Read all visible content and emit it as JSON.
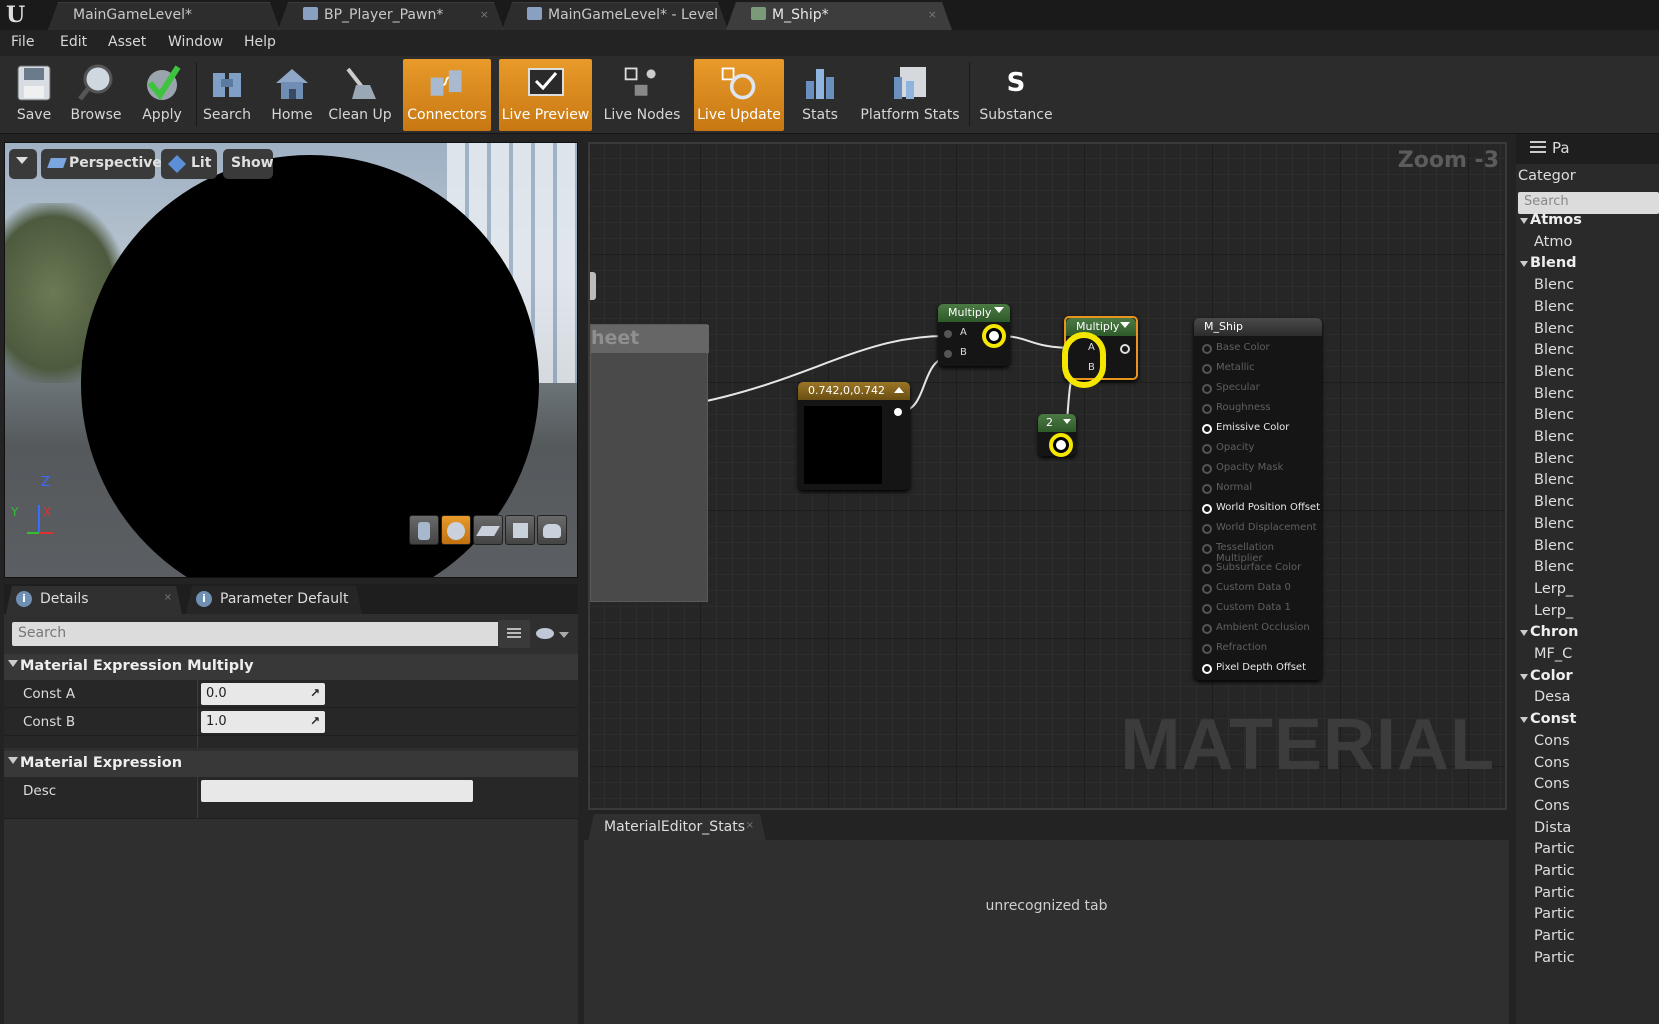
{
  "tabs": [
    {
      "label": "MainGameLevel*",
      "active": false
    },
    {
      "label": "BP_Player_Pawn*",
      "active": false
    },
    {
      "label": "MainGameLevel* - Level",
      "active": false
    },
    {
      "label": "M_Ship*",
      "active": true
    }
  ],
  "menu": [
    "File",
    "Edit",
    "Asset",
    "Window",
    "Help"
  ],
  "toolbar": [
    {
      "label": "Save",
      "icon": "save-icon",
      "on": false
    },
    {
      "label": "Browse",
      "icon": "browse-icon",
      "on": false
    },
    {
      "label": "Apply",
      "icon": "apply-icon",
      "on": false
    },
    {
      "label": "Search",
      "icon": "search-icon",
      "on": false
    },
    {
      "label": "Home",
      "icon": "home-icon",
      "on": false
    },
    {
      "label": "Clean Up",
      "icon": "clean-up-icon",
      "on": false
    },
    {
      "label": "Connectors",
      "icon": "connectors-icon",
      "on": true
    },
    {
      "label": "Live Preview",
      "icon": "live-preview-icon",
      "on": true
    },
    {
      "label": "Live Nodes",
      "icon": "live-nodes-icon",
      "on": false
    },
    {
      "label": "Live Update",
      "icon": "live-update-icon",
      "on": true
    },
    {
      "label": "Stats",
      "icon": "stats-icon",
      "on": false
    },
    {
      "label": "Platform Stats",
      "icon": "platform-stats-icon",
      "on": false
    },
    {
      "label": "Substance",
      "icon": "substance-icon",
      "on": false
    }
  ],
  "viewport": {
    "perspective": "Perspective",
    "lit": "Lit",
    "show": "Show",
    "axis_z": "Z",
    "axis_y": "Y",
    "axis_x": "X"
  },
  "details": {
    "tab_details": "Details",
    "tab_params": "Parameter Default",
    "search_placeholder": "Search",
    "section1": "Material Expression Multiply",
    "const_a_label": "Const A",
    "const_a_value": "0.0",
    "const_b_label": "Const B",
    "const_b_value": "1.0",
    "section2": "Material Expression",
    "desc_label": "Desc",
    "desc_value": ""
  },
  "graph": {
    "zoom": "Zoom -3",
    "watermark": "MATERIAL",
    "comment_title": "heet",
    "multiply1": {
      "title": "Multiply",
      "a": "A",
      "b": "B"
    },
    "multiply2": {
      "title": "Multiply",
      "a": "A",
      "b": "B"
    },
    "constant3": {
      "title": "0.742,0,0.742",
      "color": "#000000"
    },
    "constant": {
      "title": "2"
    },
    "material": {
      "title": "M_Ship",
      "inputs": [
        {
          "label": "Base Color",
          "active": false
        },
        {
          "label": "Metallic",
          "active": false
        },
        {
          "label": "Specular",
          "active": false
        },
        {
          "label": "Roughness",
          "active": false
        },
        {
          "label": "Emissive Color",
          "active": true
        },
        {
          "label": "Opacity",
          "active": false
        },
        {
          "label": "Opacity Mask",
          "active": false
        },
        {
          "label": "Normal",
          "active": false
        },
        {
          "label": "World Position Offset",
          "active": true
        },
        {
          "label": "World Displacement",
          "active": false
        },
        {
          "label": "Tessellation Multiplier",
          "active": false
        },
        {
          "label": "Subsurface Color",
          "active": false
        },
        {
          "label": "Custom Data 0",
          "active": false
        },
        {
          "label": "Custom Data 1",
          "active": false
        },
        {
          "label": "Ambient Occlusion",
          "active": false
        },
        {
          "label": "Refraction",
          "active": false
        },
        {
          "label": "Pixel Depth Offset",
          "active": true
        }
      ]
    },
    "highlight_color": "#f5e600"
  },
  "stats": {
    "tab": "MaterialEditor_Stats",
    "message": "unrecognized tab"
  },
  "palette": {
    "tab": "Pa",
    "category_label": "Categor",
    "search_placeholder": "Search",
    "rows": [
      {
        "label": "Atmos",
        "cat": true
      },
      {
        "label": "Atmo",
        "cat": false
      },
      {
        "label": "Blend",
        "cat": true
      },
      {
        "label": "Blenc",
        "cat": false
      },
      {
        "label": "Blenc",
        "cat": false
      },
      {
        "label": "Blenc",
        "cat": false
      },
      {
        "label": "Blenc",
        "cat": false
      },
      {
        "label": "Blenc",
        "cat": false
      },
      {
        "label": "Blenc",
        "cat": false
      },
      {
        "label": "Blenc",
        "cat": false
      },
      {
        "label": "Blenc",
        "cat": false
      },
      {
        "label": "Blenc",
        "cat": false
      },
      {
        "label": "Blenc",
        "cat": false
      },
      {
        "label": "Blenc",
        "cat": false
      },
      {
        "label": "Blenc",
        "cat": false
      },
      {
        "label": "Blenc",
        "cat": false
      },
      {
        "label": "Blenc",
        "cat": false
      },
      {
        "label": "Lerp_",
        "cat": false
      },
      {
        "label": "Lerp_",
        "cat": false
      },
      {
        "label": "Chron",
        "cat": true
      },
      {
        "label": "MF_C",
        "cat": false
      },
      {
        "label": "Color",
        "cat": true
      },
      {
        "label": "Desa",
        "cat": false
      },
      {
        "label": "Const",
        "cat": true
      },
      {
        "label": "Cons",
        "cat": false
      },
      {
        "label": "Cons",
        "cat": false
      },
      {
        "label": "Cons",
        "cat": false
      },
      {
        "label": "Cons",
        "cat": false
      },
      {
        "label": "Dista",
        "cat": false
      },
      {
        "label": "Partic",
        "cat": false
      },
      {
        "label": "Partic",
        "cat": false
      },
      {
        "label": "Partic",
        "cat": false
      },
      {
        "label": "Partic",
        "cat": false
      },
      {
        "label": "Partic",
        "cat": false
      },
      {
        "label": "Partic",
        "cat": false
      }
    ]
  }
}
